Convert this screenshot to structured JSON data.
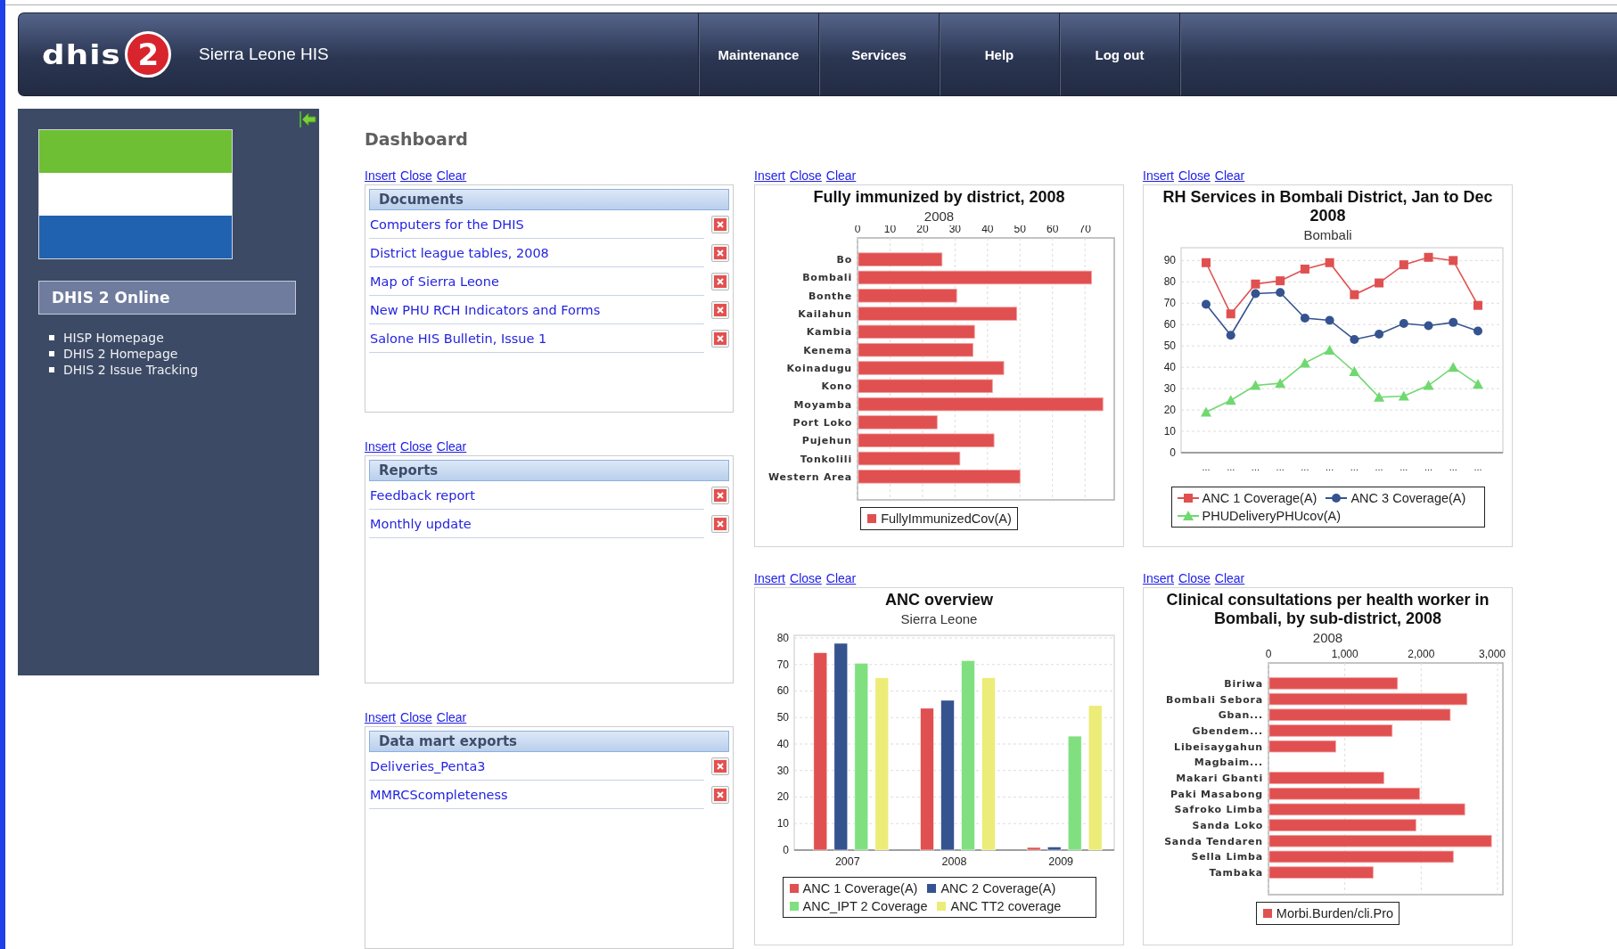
{
  "header": {
    "logo": {
      "letters": "dhis",
      "digit": "2"
    },
    "site_title": "Sierra Leone HIS",
    "nav": [
      {
        "label": "Maintenance"
      },
      {
        "label": "Services"
      },
      {
        "label": "Help"
      },
      {
        "label": "Log out"
      }
    ]
  },
  "sidebar": {
    "title": "DHIS 2 Online",
    "links": [
      "HISP Homepage",
      "DHIS 2 Homepage",
      "DHIS 2 Issue Tracking"
    ]
  },
  "dashboard": {
    "title": "Dashboard",
    "lists": [
      {
        "actions": [
          "Insert",
          "Close",
          "Clear"
        ],
        "heading": "Documents",
        "items": [
          "Computers for the DHIS",
          "District league tables, 2008",
          "Map of Sierra Leone",
          "New PHU RCH Indicators and Forms",
          "Salone HIS Bulletin, Issue 1"
        ]
      },
      {
        "actions": [
          "Insert",
          "Close",
          "Clear"
        ],
        "heading": "Reports",
        "items": [
          "Feedback report",
          "Monthly update"
        ]
      },
      {
        "actions": [
          "Insert",
          "Close",
          "Clear"
        ],
        "heading": "Data mart exports",
        "items": [
          "Deliveries_Penta3",
          "MMRCScompleteness"
        ]
      }
    ],
    "charts": [
      {
        "actions": [
          "Insert",
          "Close",
          "Clear"
        ],
        "subtitle": "2008",
        "chart_data": {
          "type": "bar",
          "orientation": "horizontal",
          "title": "Fully immunized by district, 2008",
          "categories": [
            "Bo",
            "Bombali",
            "Bonthe",
            "Kailahun",
            "Kambia",
            "Kenema",
            "Koinadugu",
            "Kono",
            "Moyamba",
            "Port Loko",
            "Pujehun",
            "Tonkolili",
            "Western Area"
          ],
          "series": [
            {
              "name": "FullyImmunizedCov(A)",
              "color": "#e05050",
              "values": [
                26,
                72,
                30.5,
                49,
                36,
                35.5,
                45,
                41.5,
                75.5,
                24.5,
                42,
                31.5,
                50
              ]
            }
          ],
          "xlim": [
            0,
            79
          ],
          "xticks": [
            0,
            10,
            20,
            30,
            40,
            50,
            60,
            70
          ],
          "grid": true
        }
      },
      {
        "actions": [
          "Insert",
          "Close",
          "Clear"
        ],
        "subtitle": "Bombali",
        "chart_data": {
          "type": "line",
          "title": "RH Services in Bombali District, Jan to Dec 2008",
          "categories": [
            "...",
            "...",
            "...",
            "...",
            "...",
            "...",
            "...",
            "...",
            "...",
            "...",
            "...",
            "..."
          ],
          "series": [
            {
              "name": "ANC 1 Coverage(A)",
              "color": "#e05050",
              "marker": "square",
              "values": [
                89,
                65,
                79,
                80.5,
                86,
                89,
                74,
                79.5,
                88,
                91.5,
                90,
                69
              ]
            },
            {
              "name": "ANC 3 Coverage(A)",
              "color": "#35538f",
              "marker": "circle",
              "values": [
                69.5,
                55,
                74.5,
                75,
                63,
                62,
                53,
                55.5,
                60.5,
                59.5,
                61,
                57
              ]
            },
            {
              "name": "PHUDeliveryPHUcov(A)",
              "color": "#70d870",
              "marker": "triangle",
              "values": [
                19,
                24.5,
                31.5,
                32.5,
                42,
                48,
                38,
                26,
                26.5,
                31.5,
                40,
                32
              ]
            }
          ],
          "ylim": [
            0,
            96
          ],
          "yticks": [
            0,
            10,
            20,
            30,
            40,
            50,
            60,
            70,
            80,
            90
          ],
          "grid": true
        }
      },
      {
        "actions": [
          "Insert",
          "Close",
          "Clear"
        ],
        "subtitle": "Sierra Leone",
        "chart_data": {
          "type": "bar",
          "orientation": "vertical",
          "title": "ANC overview",
          "categories": [
            "2007",
            "2008",
            "2009"
          ],
          "series": [
            {
              "name": "ANC 1 Coverage(A)",
              "color": "#e05050",
              "values": [
                74.5,
                53.5,
                1
              ]
            },
            {
              "name": "ANC 2 Coverage(A)",
              "color": "#35538f",
              "values": [
                78,
                56.5,
                1.2
              ]
            },
            {
              "name": "ANC_IPT 2 Coverage",
              "color": "#80e080",
              "values": [
                70.5,
                71.5,
                43
              ]
            },
            {
              "name": "ANC TT2 coverage",
              "color": "#ecec78",
              "values": [
                65,
                65,
                54.5
              ]
            }
          ],
          "ylim": [
            0,
            81
          ],
          "yticks": [
            0,
            10,
            20,
            30,
            40,
            50,
            60,
            70,
            80
          ],
          "grid": true
        }
      },
      {
        "actions": [
          "Insert",
          "Close",
          "Clear"
        ],
        "subtitle": "2008",
        "chart_data": {
          "type": "bar",
          "orientation": "horizontal",
          "title": "Clinical consultations per health worker in Bombali, by sub-district, 2008",
          "categories": [
            "Biriwa",
            "Bombali Sebora",
            "Gban...",
            "Gbendem...",
            "Libeisaygahun",
            "Magbaim...",
            "Makari Gbanti",
            "Paki Masabong",
            "Safroko Limba",
            "Sanda Loko",
            "Sanda Tendaren",
            "Sella Limba",
            "Tambaka"
          ],
          "series": [
            {
              "name": "Morbi.Burden/cli.Pro",
              "color": "#e05050",
              "values": [
                1690,
                2600,
                2380,
                1620,
                880,
                null,
                1510,
                1980,
                2570,
                1930,
                2920,
                2420,
                1370
              ]
            }
          ],
          "xlim": [
            0,
            3070
          ],
          "xticks": [
            0,
            {
              "value": 1000,
              "label": "1,000"
            },
            {
              "value": 2000,
              "label": "2,000"
            },
            {
              "value": 3000,
              "label": "3,000"
            }
          ],
          "grid": true
        }
      }
    ]
  }
}
